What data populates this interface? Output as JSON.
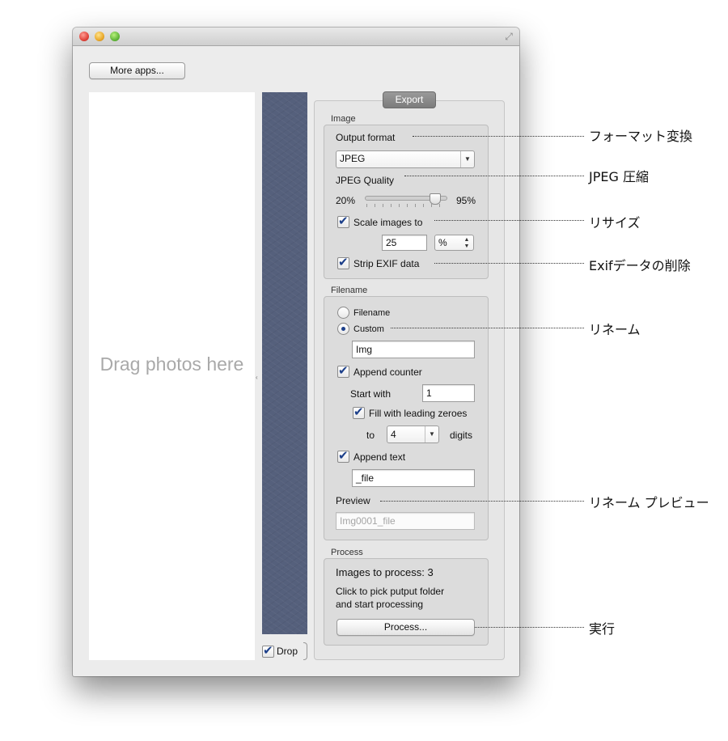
{
  "window": {
    "controls": [
      "close",
      "minimize",
      "zoom"
    ],
    "fullscreen_icon": "fullscreen-arrows-icon"
  },
  "toolbar": {
    "more_apps_label": "More apps..."
  },
  "drop_area": {
    "hint": "Drag photos here"
  },
  "drop_toggle": {
    "label": "Drop",
    "checked": true
  },
  "export": {
    "tab_label": "Export",
    "image": {
      "section_label": "Image",
      "output_format_label": "Output format",
      "output_format_value": "JPEG",
      "jpeg_quality_label": "JPEG Quality",
      "quality_min_label": "20%",
      "quality_max_label": "95%",
      "quality_fraction": 0.87,
      "scale_label": "Scale images to",
      "scale_checked": true,
      "scale_value": "25",
      "scale_unit": "%",
      "strip_exif_label": "Strip EXIF data",
      "strip_exif_checked": true
    },
    "filename": {
      "section_label": "Filename",
      "radio_filename_label": "Filename",
      "radio_custom_label": "Custom",
      "selected": "Custom",
      "custom_value": "Img",
      "append_counter_label": "Append counter",
      "append_counter_checked": true,
      "start_with_label": "Start with",
      "start_with_value": "1",
      "fill_zeroes_label": "Fill with leading zeroes",
      "fill_zeroes_checked": true,
      "to_label": "to",
      "digits_value": "4",
      "digits_label": "digits",
      "append_text_label": "Append text",
      "append_text_checked": true,
      "append_text_value": "_file",
      "preview_label": "Preview",
      "preview_value": "Img0001_file"
    },
    "process": {
      "section_label": "Process",
      "images_to_process": "Images to process: 3",
      "hint_line1": "Click to pick putput folder",
      "hint_line2": "and start processing",
      "button_label": "Process..."
    }
  },
  "callouts": {
    "format": "フォーマット変換",
    "jpeg": "JPEG 圧縮",
    "resize": "リサイズ",
    "exif": "Exifデータの削除",
    "rename": "リネーム",
    "preview": "リネーム プレビュー",
    "run": "実行"
  }
}
